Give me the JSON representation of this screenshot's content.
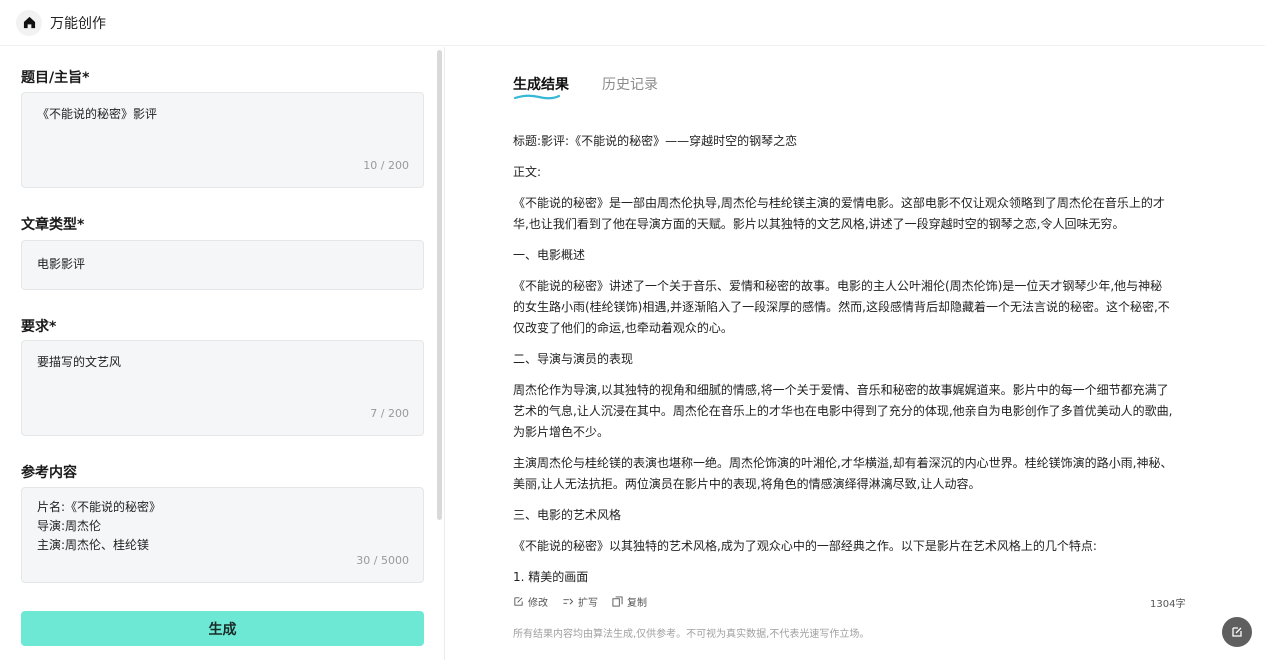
{
  "app": {
    "title": "万能创作"
  },
  "form": {
    "topic": {
      "label": "题目/主旨*",
      "value": "《不能说的秘密》影评",
      "counter": "10 / 200"
    },
    "type": {
      "label": "文章类型*",
      "value": "电影影评"
    },
    "requirement": {
      "label": "要求*",
      "value": "要描写的文艺风",
      "counter": "7 / 200"
    },
    "reference": {
      "label": "参考内容",
      "lines": [
        "片名:《不能说的秘密》",
        "导演:周杰伦",
        "主演:周杰伦、桂纶镁"
      ],
      "counter": "30 / 5000"
    },
    "generate_label": "生成"
  },
  "tabs": {
    "result": "生成结果",
    "history": "历史记录"
  },
  "result": {
    "paragraphs": [
      "标题:影评:《不能说的秘密》——穿越时空的钢琴之恋",
      "正文:",
      "《不能说的秘密》是一部由周杰伦执导,周杰伦与桂纶镁主演的爱情电影。这部电影不仅让观众领略到了周杰伦在音乐上的才华,也让我们看到了他在导演方面的天赋。影片以其独特的文艺风格,讲述了一段穿越时空的钢琴之恋,令人回味无穷。",
      "一、电影概述",
      "《不能说的秘密》讲述了一个关于音乐、爱情和秘密的故事。电影的主人公叶湘伦(周杰伦饰)是一位天才钢琴少年,他与神秘的女生路小雨(桂纶镁饰)相遇,并逐渐陷入了一段深厚的感情。然而,这段感情背后却隐藏着一个无法言说的秘密。这个秘密,不仅改变了他们的命运,也牵动着观众的心。",
      "二、导演与演员的表现",
      "周杰伦作为导演,以其独特的视角和细腻的情感,将一个关于爱情、音乐和秘密的故事娓娓道来。影片中的每一个细节都充满了艺术的气息,让人沉浸在其中。周杰伦在音乐上的才华也在电影中得到了充分的体现,他亲自为电影创作了多首优美动人的歌曲,为影片增色不少。",
      "主演周杰伦与桂纶镁的表演也堪称一绝。周杰伦饰演的叶湘伦,才华横溢,却有着深沉的内心世界。桂纶镁饰演的路小雨,神秘、美丽,让人无法抗拒。两位演员在影片中的表现,将角色的情感演绎得淋漓尽致,让人动容。",
      "三、电影的艺术风格",
      "《不能说的秘密》以其独特的艺术风格,成为了观众心中的一部经典之作。以下是影片在艺术风格上的几个特点:",
      "1. 精美的画面"
    ],
    "actions": {
      "edit": "修改",
      "expand": "扩写",
      "copy": "复制"
    },
    "word_count": "1304字",
    "disclaimer": "所有结果内容均由算法生成,仅供参考。不可视为真实数据,不代表光速写作立场。"
  },
  "colors": {
    "accent": "#6de8d4",
    "underline": "#37b8d6"
  },
  "icons": [
    "home-icon",
    "edit-icon",
    "expand-icon",
    "copy-icon",
    "compose-icon"
  ]
}
